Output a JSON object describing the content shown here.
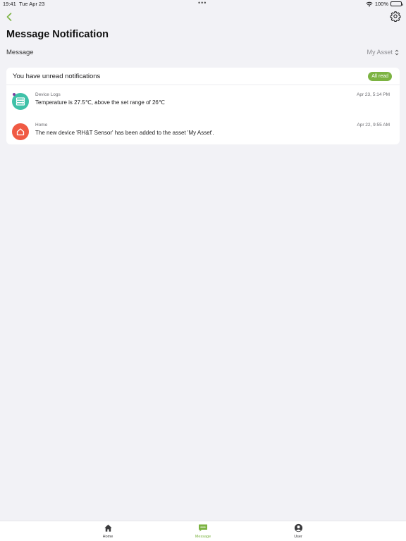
{
  "status_bar": {
    "time": "19:41",
    "date": "Tue Apr 23",
    "multitask": "•••",
    "battery": "100%"
  },
  "header": {
    "title": "Message Notification",
    "back_icon": "chevron-left-icon",
    "settings_icon": "gear-icon"
  },
  "filter": {
    "label": "Message",
    "selected": "My Asset"
  },
  "notifications": {
    "header": "You have unread notifications",
    "all_read_label": "All read",
    "items": [
      {
        "category": "Device Logs",
        "text": "Temperature is 27.5℃, above the set range of 26℃",
        "time": "Apr 23, 5:14 PM",
        "icon": "device-logs-icon",
        "color": "#3fc1a8",
        "unread": true
      },
      {
        "category": "Home",
        "text": "The new device 'RH&T Sensor' has been added to the asset 'My Asset'.",
        "time": "Apr 22, 9:55 AM",
        "icon": "home-icon",
        "color": "#f05a44",
        "unread": false
      }
    ]
  },
  "tabs": [
    {
      "label": "Home",
      "icon": "home-icon",
      "active": false
    },
    {
      "label": "Message",
      "icon": "message-icon",
      "active": true
    },
    {
      "label": "User",
      "icon": "user-icon",
      "active": false
    }
  ],
  "colors": {
    "accent": "#7cb342",
    "background": "#f2f2f6"
  }
}
